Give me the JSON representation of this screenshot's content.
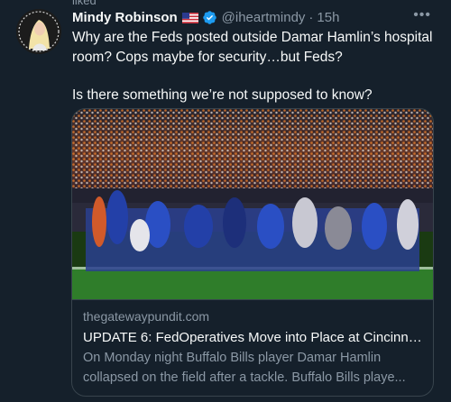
{
  "context": {
    "label": "liked"
  },
  "tweet": {
    "display_name": "Mindy Robinson",
    "flag_icon": "us-flag-icon",
    "verified_icon": "verified-badge-icon",
    "handle": "@iheartmindy",
    "separator": "·",
    "time": "15h",
    "more_icon": "more-options-icon",
    "more_glyph": "•••",
    "text_line1": "Why are the Feds posted outside Damar Hamlin’s hospital room? Cops maybe for security…but Feds?",
    "text_line2": "Is there something we’re not supposed to know?"
  },
  "card": {
    "domain": "thegatewaypundit.com",
    "title": "UPDATE 6: FedOperatives Move into Place at Cincinnati...",
    "description_line1": "On Monday night Buffalo Bills player Damar Hamlin",
    "description_line2": "collapsed on the field after a tackle.  Buffalo Bills playe..."
  },
  "colors": {
    "background": "#15202b",
    "primary_text": "#f7f9f9",
    "secondary_text": "#8b98a5",
    "border": "#38444d",
    "verified": "#1d9bf0"
  }
}
